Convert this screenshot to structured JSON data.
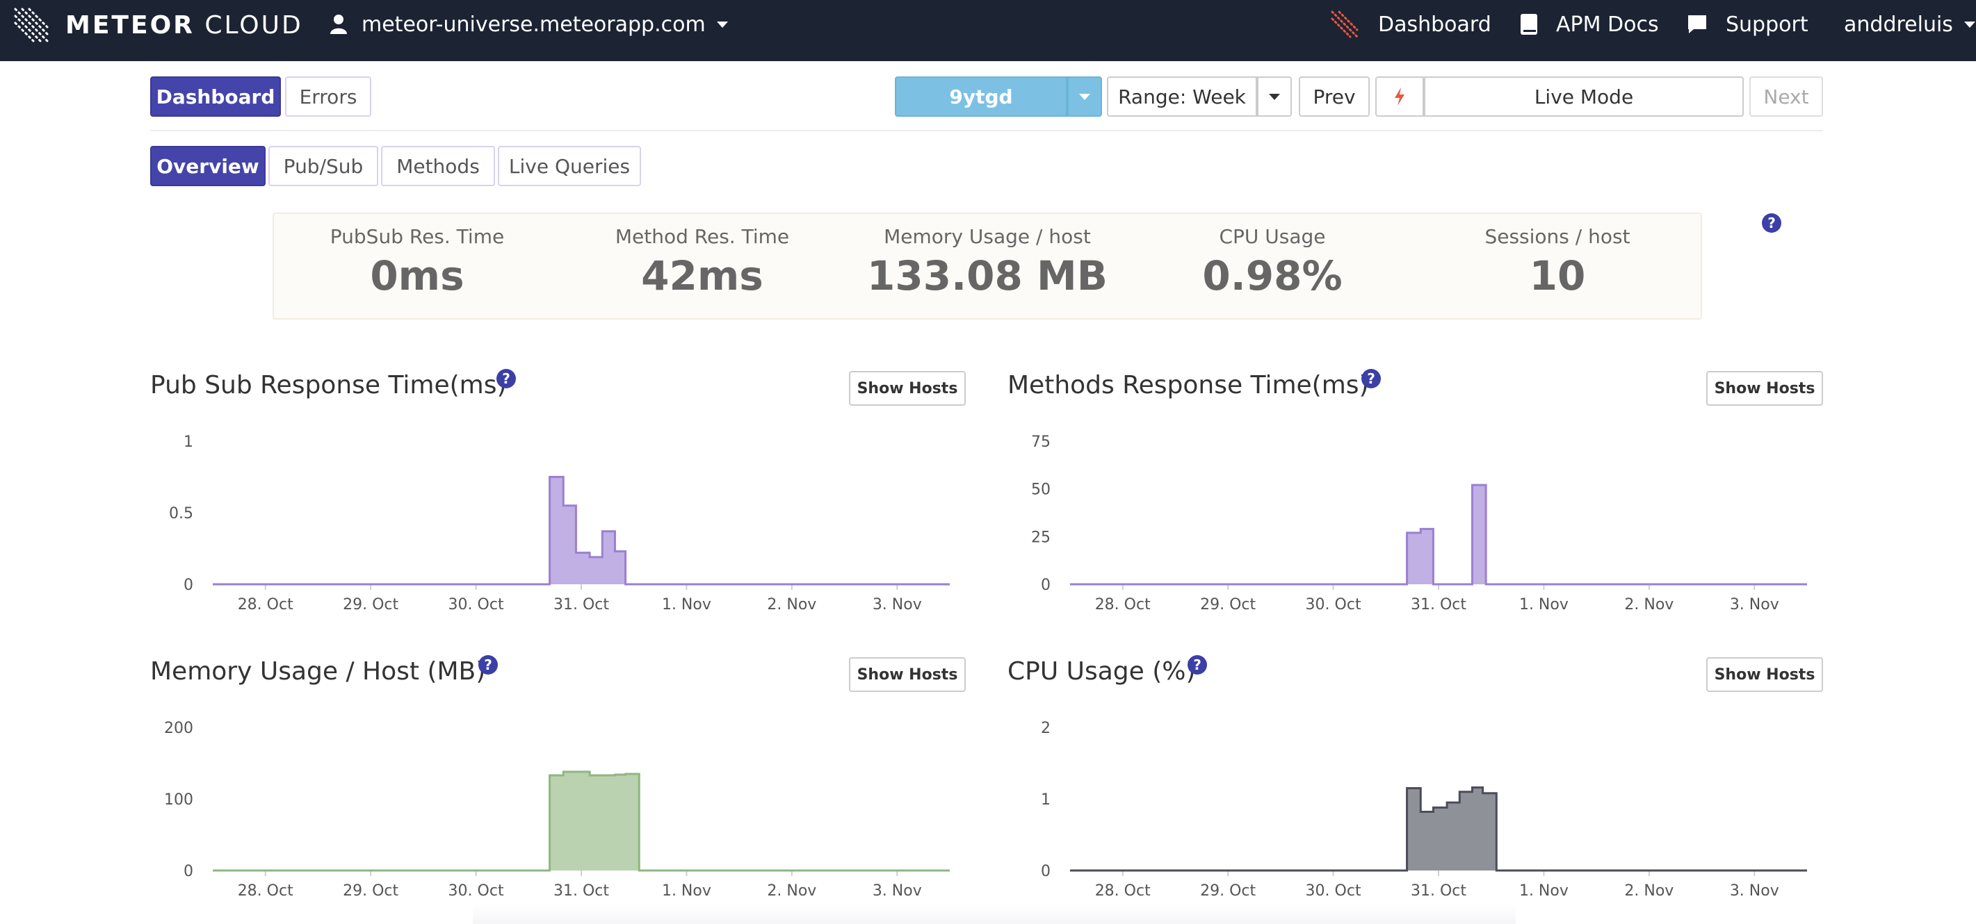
{
  "topbar": {
    "brand_bold": "METEOR",
    "brand_light": "CLOUD",
    "app_name": "meteor-universe.meteorapp.com",
    "links": [
      {
        "label": "Dashboard",
        "icon": "meteor-icon"
      },
      {
        "label": "APM Docs",
        "icon": "book-icon"
      },
      {
        "label": "Support",
        "icon": "chat-icon"
      }
    ],
    "user": "anddreluis"
  },
  "toolbar": {
    "tabs": [
      "Dashboard",
      "Errors"
    ],
    "host": "9ytgd",
    "range": "Range: Week",
    "prev": "Prev",
    "live_mode": "Live Mode",
    "next": "Next",
    "colors": {
      "primary": "#4444aa",
      "host_button": "#7cc1e4",
      "bolt": "#e8573f"
    }
  },
  "subtabs": [
    "Overview",
    "Pub/Sub",
    "Methods",
    "Live Queries"
  ],
  "summary": {
    "metrics": [
      {
        "label": "PubSub Res. Time",
        "value": "0ms"
      },
      {
        "label": "Method Res. Time",
        "value": "42ms"
      },
      {
        "label": "Memory Usage / host",
        "value": "133.08 MB"
      },
      {
        "label": "CPU Usage",
        "value": "0.98%"
      },
      {
        "label": "Sessions / host",
        "value": "10"
      }
    ],
    "help": "?"
  },
  "show_hosts_label": "Show Hosts",
  "charts": [
    {
      "title": "Pub Sub Response Time(ms)"
    },
    {
      "title": "Methods Response Time(ms)"
    },
    {
      "title": "Memory Usage / Host (MB)"
    },
    {
      "title": "CPU Usage (%)"
    }
  ],
  "chart_data": [
    {
      "type": "area",
      "title": "Pub Sub Response Time(ms)",
      "x_ticks": [
        "28. Oct",
        "29. Oct",
        "30. Oct",
        "31. Oct",
        "1. Nov",
        "2. Nov",
        "3. Nov"
      ],
      "ylim": [
        0,
        1
      ],
      "y_ticks": [
        "0",
        "0.5",
        "1"
      ],
      "color": "#9b7fd4",
      "series": [
        {
          "x": [
            30.7,
            30.83,
            30.83,
            30.95,
            30.95,
            31.08,
            31.08,
            31.2,
            31.2,
            31.32,
            31.32,
            31.42,
            31.42,
            31.55
          ],
          "y": [
            0.75,
            0.75,
            0.55,
            0.55,
            0.22,
            0.22,
            0.19,
            0.19,
            0.37,
            0.37,
            0.23,
            0.23,
            0,
            0
          ]
        }
      ]
    },
    {
      "type": "area",
      "title": "Methods Response Time(ms)",
      "x_ticks": [
        "28. Oct",
        "29. Oct",
        "30. Oct",
        "31. Oct",
        "1. Nov",
        "2. Nov",
        "3. Nov"
      ],
      "ylim": [
        0,
        75
      ],
      "y_ticks": [
        "0",
        "25",
        "50",
        "75"
      ],
      "color": "#9b7fd4",
      "series": [
        {
          "x": [
            30.7,
            30.83,
            30.83,
            30.95,
            30.95,
            31.32,
            31.32,
            31.45,
            31.45
          ],
          "y": [
            27,
            27,
            29,
            29,
            0,
            0,
            52,
            52,
            0
          ]
        }
      ]
    },
    {
      "type": "area",
      "title": "Memory Usage / Host (MB)",
      "x_ticks": [
        "28. Oct",
        "29. Oct",
        "30. Oct",
        "31. Oct",
        "1. Nov",
        "2. Nov",
        "3. Nov"
      ],
      "ylim": [
        0,
        200
      ],
      "y_ticks": [
        "0",
        "100",
        "200"
      ],
      "color": "#8fb780",
      "series": [
        {
          "x": [
            30.7,
            30.83,
            30.83,
            31.08,
            31.08,
            31.32,
            31.32,
            31.42,
            31.42,
            31.55,
            31.55
          ],
          "y": [
            133,
            133,
            138,
            138,
            133,
            133,
            134,
            134,
            135,
            135,
            0
          ]
        }
      ]
    },
    {
      "type": "area",
      "title": "CPU Usage (%)",
      "x_ticks": [
        "28. Oct",
        "29. Oct",
        "30. Oct",
        "31. Oct",
        "1. Nov",
        "2. Nov",
        "3. Nov"
      ],
      "ylim": [
        0,
        2
      ],
      "y_ticks": [
        "0",
        "1",
        "2"
      ],
      "color": "#4b4d5a",
      "series": [
        {
          "x": [
            30.7,
            30.83,
            30.83,
            30.95,
            30.95,
            31.08,
            31.08,
            31.2,
            31.2,
            31.32,
            31.32,
            31.42,
            31.42,
            31.55,
            31.55
          ],
          "y": [
            1.15,
            1.15,
            0.82,
            0.82,
            0.88,
            0.88,
            0.95,
            0.95,
            1.1,
            1.1,
            1.16,
            1.16,
            1.08,
            1.08,
            0
          ]
        }
      ]
    }
  ]
}
